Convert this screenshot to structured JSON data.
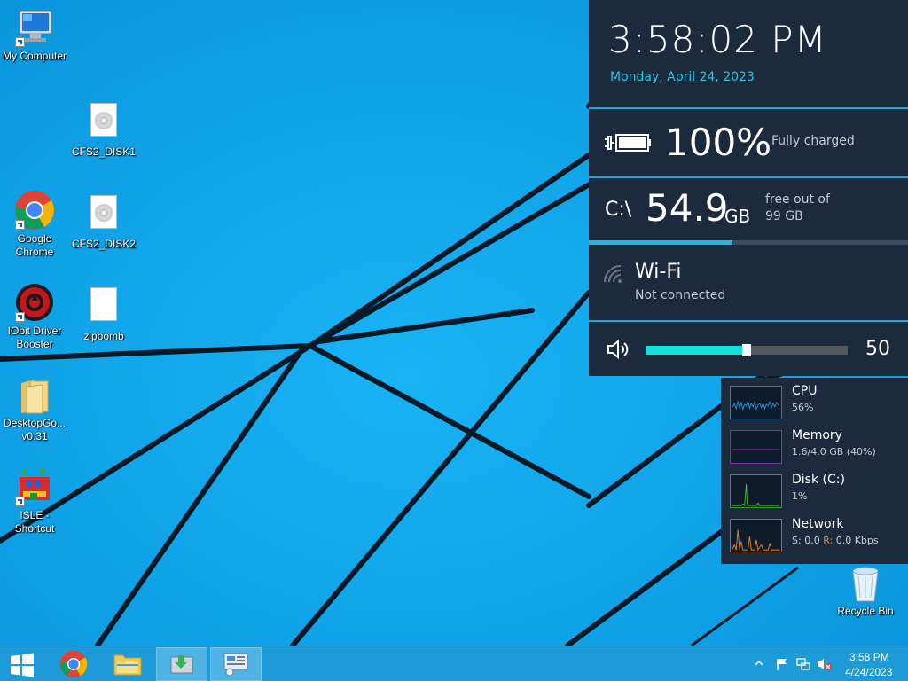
{
  "desktop_icons": [
    {
      "label": "My Computer",
      "icon": "my-computer-icon"
    },
    {
      "label": "CFS2_DISK1",
      "icon": "disc-image-icon"
    },
    {
      "label": "Google Chrome",
      "icon": "chrome-icon"
    },
    {
      "label": "CFS2_DISK2",
      "icon": "disc-image-icon"
    },
    {
      "label": "IObit Driver Booster",
      "icon": "driver-booster-icon"
    },
    {
      "label": "zipbomb",
      "icon": "blank-file-icon"
    },
    {
      "label": "DesktopGo... v0.31",
      "icon": "folder-icon"
    },
    {
      "label": "ISLE - Shortcut",
      "icon": "isle-icon"
    },
    {
      "label": "Recycle Bin",
      "icon": "recycle-bin-icon"
    }
  ],
  "panel": {
    "time": "3:58:02 PM",
    "date": "Monday, April 24, 2023",
    "battery": {
      "percent": "100%",
      "status": "Fully charged"
    },
    "drive": {
      "letter": "C:\\",
      "free": "54.9",
      "unit": "GB",
      "line1": "free out of",
      "line2": "99 GB",
      "used_fraction": 0.45
    },
    "wifi": {
      "name": "Wi-Fi",
      "status": "Not connected"
    },
    "volume": {
      "value": "50",
      "level": 0.5
    }
  },
  "perf": {
    "cpu": {
      "title": "CPU",
      "value": "56%"
    },
    "memory": {
      "title": "Memory",
      "value": "1.6/4.0 GB (40%)"
    },
    "disk": {
      "title": "Disk (C:)",
      "value": "1%"
    },
    "network": {
      "title": "Network",
      "s_label": "S:",
      "s_value": "0.0",
      "r_label": "R:",
      "r_value": "0.0 Kbps"
    }
  },
  "taskbar": {
    "clock_time": "3:58 PM",
    "clock_date": "4/24/2023",
    "buttons": [
      "start-button",
      "chrome-taskbar-button",
      "file-explorer-taskbar-button",
      "app-taskbar-button-1",
      "app-taskbar-button-2"
    ]
  },
  "colors": {
    "accent": "#27c8e0",
    "panel_bg": "#1b2a3c",
    "desktop": "#0aa6f0",
    "volume": "#10e3de"
  }
}
